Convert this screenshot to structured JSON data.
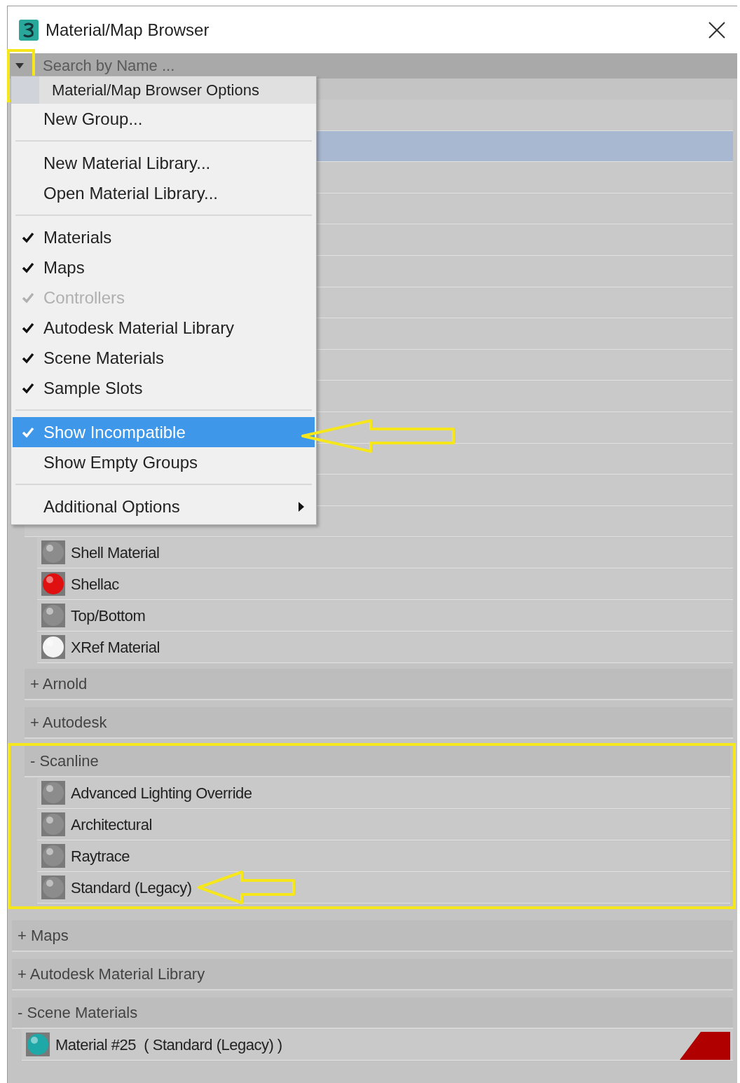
{
  "window": {
    "title": "Material/Map Browser"
  },
  "search": {
    "placeholder": "Search by Name ..."
  },
  "menu": {
    "items": [
      {
        "kind": "header",
        "label": "Material/Map Browser Options"
      },
      {
        "kind": "item",
        "label": "New Group...",
        "checked": false,
        "disabled": false,
        "selected": false
      },
      {
        "kind": "separator"
      },
      {
        "kind": "item",
        "label": "New Material Library...",
        "checked": false,
        "disabled": false,
        "selected": false
      },
      {
        "kind": "item",
        "label": "Open Material Library...",
        "checked": false,
        "disabled": false,
        "selected": false
      },
      {
        "kind": "separator"
      },
      {
        "kind": "item",
        "label": "Materials",
        "checked": true,
        "disabled": false,
        "selected": false
      },
      {
        "kind": "item",
        "label": "Maps",
        "checked": true,
        "disabled": false,
        "selected": false
      },
      {
        "kind": "item",
        "label": "Controllers",
        "checked": true,
        "disabled": true,
        "selected": false
      },
      {
        "kind": "item",
        "label": "Autodesk Material Library",
        "checked": true,
        "disabled": false,
        "selected": false
      },
      {
        "kind": "item",
        "label": "Scene Materials",
        "checked": true,
        "disabled": false,
        "selected": false
      },
      {
        "kind": "item",
        "label": "Sample Slots",
        "checked": true,
        "disabled": false,
        "selected": false
      },
      {
        "kind": "separator"
      },
      {
        "kind": "item",
        "label": "Show Incompatible",
        "checked": true,
        "disabled": false,
        "selected": true
      },
      {
        "kind": "item",
        "label": "Show Empty Groups",
        "checked": false,
        "disabled": false,
        "selected": false
      },
      {
        "kind": "separator"
      },
      {
        "kind": "submenu",
        "label": "Additional Options",
        "checked": false,
        "disabled": false,
        "selected": false
      }
    ]
  },
  "rows_behind_menu": [
    {
      "selected": false
    },
    {
      "selected": true
    },
    {
      "selected": false
    },
    {
      "selected": false
    },
    {
      "selected": false
    },
    {
      "selected": false
    },
    {
      "selected": false
    },
    {
      "selected": false
    },
    {
      "selected": false
    },
    {
      "selected": false
    },
    {
      "selected": false
    },
    {
      "selected": false
    },
    {
      "selected": false
    },
    {
      "selected": false
    }
  ],
  "materials": [
    {
      "label": "Shell Material",
      "color": "#8c8c8c"
    },
    {
      "label": "Shellac",
      "color": "#e01010"
    },
    {
      "label": "Top/Bottom",
      "color": "#8c8c8c"
    },
    {
      "label": "XRef Material",
      "color": "#f4f4f4"
    }
  ],
  "subgroups": [
    {
      "label": "+ Arnold",
      "highlighted": false
    },
    {
      "label": "+ Autodesk",
      "highlighted": false
    },
    {
      "label": "- Scanline",
      "highlighted": true,
      "items": [
        {
          "label": "Advanced Lighting Override",
          "color": "#8c8c8c",
          "pointed": false
        },
        {
          "label": "Architectural",
          "color": "#8c8c8c",
          "pointed": false
        },
        {
          "label": "Raytrace",
          "color": "#8c8c8c",
          "pointed": false
        },
        {
          "label": "Standard (Legacy)",
          "color": "#8c8c8c",
          "pointed": true
        }
      ]
    }
  ],
  "groups": [
    {
      "label": "+ Maps"
    },
    {
      "label": "+ Autodesk Material Library"
    },
    {
      "label": "- Scene Materials",
      "items": [
        {
          "label": "Material #25  ( Standard (Legacy) )",
          "color": "#1fa8a8",
          "in_use": true
        }
      ]
    }
  ]
}
